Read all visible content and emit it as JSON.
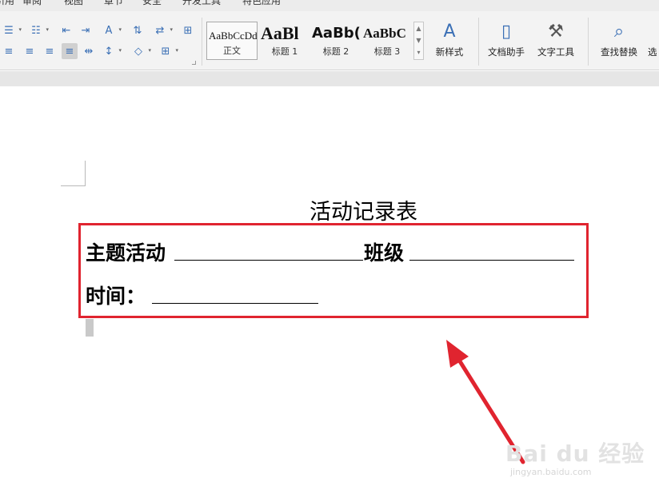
{
  "menu": {
    "tabs": [
      "引用",
      "审阅",
      "视图",
      "章节",
      "安全",
      "开发工具",
      "特色应用"
    ]
  },
  "styles": {
    "items": [
      {
        "sample": "AaBbCcDd",
        "label": "正文"
      },
      {
        "sample": "AaBl",
        "label": "标题 1"
      },
      {
        "sample": "AaBb(",
        "label": "标题 2"
      },
      {
        "sample": "AaBbC",
        "label": "标题 3"
      }
    ],
    "new_style_label": "新样式"
  },
  "ribbon": {
    "doc_helper_label": "文档助手",
    "text_tools_label": "文字工具",
    "find_replace_label": "查找替换",
    "select_label": "选"
  },
  "document": {
    "title": "活动记录表",
    "line1_label1": "主题活动",
    "line1_label2": "班级",
    "line2_label": "时间："
  },
  "colors": {
    "highlight_box": "#e0242f",
    "arrow": "#e0242f",
    "ribbon_icon": "#3a6fb5"
  },
  "watermark": {
    "text": "Bai du 经验",
    "url": "jingyan.baidu.com"
  }
}
